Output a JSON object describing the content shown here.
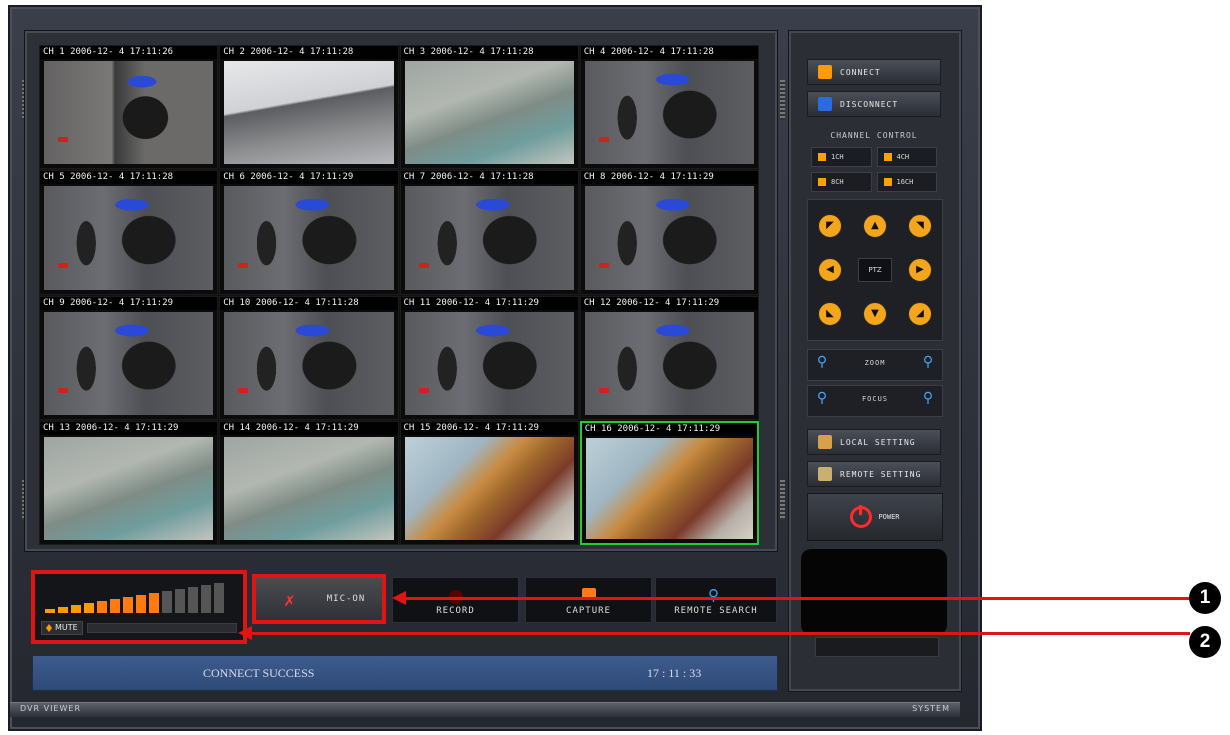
{
  "channels": [
    {
      "label": "CH 1 2006-12- 4 17:11:26",
      "scene": "door"
    },
    {
      "label": "CH 2 2006-12- 4 17:11:28",
      "scene": "room"
    },
    {
      "label": "CH 3 2006-12- 4 17:11:28",
      "scene": "outdoor"
    },
    {
      "label": "CH 4 2006-12- 4 17:11:28",
      "scene": "figure"
    },
    {
      "label": "CH 5 2006-12- 4 17:11:28",
      "scene": "figure"
    },
    {
      "label": "CH 6 2006-12- 4 17:11:29",
      "scene": "figure"
    },
    {
      "label": "CH 7 2006-12- 4 17:11:28",
      "scene": "figure"
    },
    {
      "label": "CH 8 2006-12- 4 17:11:29",
      "scene": "figure"
    },
    {
      "label": "CH 9 2006-12- 4 17:11:29",
      "scene": "figure"
    },
    {
      "label": "CH 10 2006-12- 4 17:11:28",
      "scene": "figure"
    },
    {
      "label": "CH 11 2006-12- 4 17:11:29",
      "scene": "figure"
    },
    {
      "label": "CH 12 2006-12- 4 17:11:29",
      "scene": "figure"
    },
    {
      "label": "CH 13 2006-12- 4 17:11:29",
      "scene": "outdoor"
    },
    {
      "label": "CH 14 2006-12- 4 17:11:29",
      "scene": "outdoor"
    },
    {
      "label": "CH 15 2006-12- 4 17:11:29",
      "scene": "office"
    },
    {
      "label": "CH 16 2006-12- 4 17:11:29",
      "scene": "office",
      "active": true
    }
  ],
  "audio": {
    "mute_label": "MUTE",
    "level_fraction": 0.67
  },
  "controls": {
    "mic_label": "MIC-ON",
    "record_label": "RECORD",
    "capture_label": "CAPTURE",
    "remote_search_label": "REMOTE SEARCH"
  },
  "status": {
    "message": "CONNECT SUCCESS",
    "time": "17 : 11 : 33"
  },
  "right_panel": {
    "connect_label": "CONNECT",
    "disconnect_label": "DISCONNECT",
    "channel_control_title": "CHANNEL CONTROL",
    "channel_buttons": [
      "1CH",
      "4CH",
      "8CH",
      "16CH"
    ],
    "ptz_label": "PTZ",
    "zoom_label": "ZOOM",
    "focus_label": "FOCUS",
    "local_setting_label": "LOCAL SETTING",
    "remote_setting_label": "REMOTE SETTING",
    "power_label": "POWER"
  },
  "footer": {
    "left": "DVR VIEWER",
    "right": "SYSTEM"
  },
  "callouts": [
    "1",
    "2"
  ],
  "colors": {
    "accent_orange": "#ff9a00",
    "callout_red": "#e01414",
    "status_blue": "#3d5b8d",
    "active_channel": "#22cc33"
  }
}
